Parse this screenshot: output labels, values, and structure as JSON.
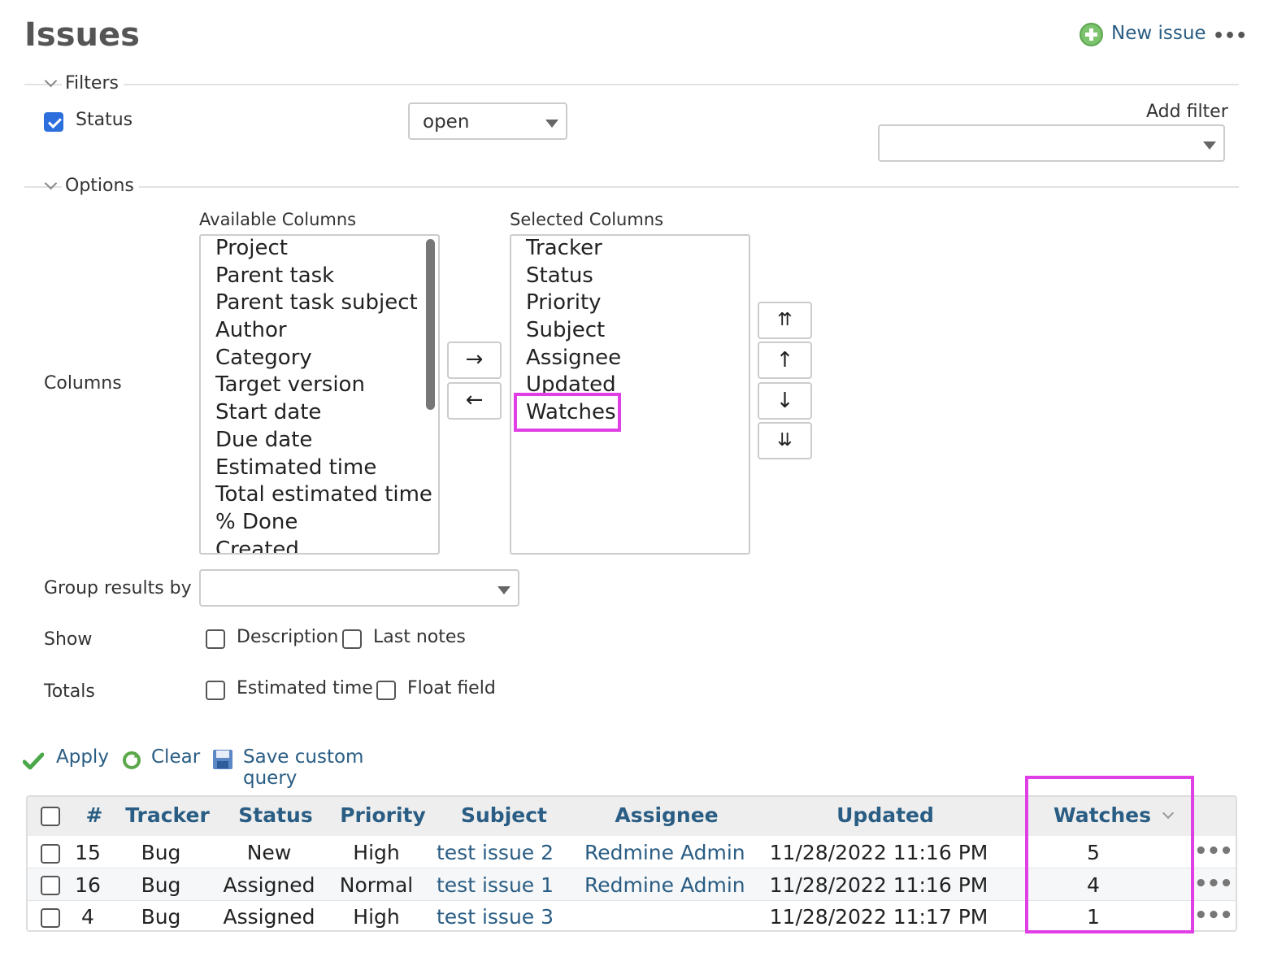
{
  "page": {
    "title": "Issues"
  },
  "header": {
    "new_issue_label": "New issue",
    "more_label": "•••"
  },
  "filters": {
    "legend": "Filters",
    "status_label": "Status",
    "status_operator": "open",
    "add_filter_label": "Add filter",
    "add_filter_value": ""
  },
  "options": {
    "legend": "Options",
    "columns_label": "Columns",
    "available_label": "Available Columns",
    "available_columns": [
      "Project",
      "Parent task",
      "Parent task subject",
      "Author",
      "Category",
      "Target version",
      "Start date",
      "Due date",
      "Estimated time",
      "Total estimated time",
      "% Done",
      "Created"
    ],
    "selected_label": "Selected Columns",
    "selected_columns": [
      "Tracker",
      "Status",
      "Priority",
      "Subject",
      "Assignee",
      "Updated",
      "Watches"
    ],
    "add_arrow": "→",
    "remove_arrow": "←",
    "move_top": "⇈",
    "move_up": "↑",
    "move_down": "↓",
    "move_bottom": "⇊",
    "group_by_label": "Group results by",
    "group_by_value": "",
    "show_label": "Show",
    "show_description": "Description",
    "show_last_notes": "Last notes",
    "totals_label": "Totals",
    "totals_estimated": "Estimated time",
    "totals_float": "Float field"
  },
  "actions": {
    "apply": "Apply",
    "clear": "Clear",
    "save": "Save custom query"
  },
  "table": {
    "headers": {
      "id": "#",
      "tracker": "Tracker",
      "status": "Status",
      "priority": "Priority",
      "subject": "Subject",
      "assignee": "Assignee",
      "updated": "Updated",
      "watches": "Watches"
    },
    "rows": [
      {
        "id": "15",
        "tracker": "Bug",
        "status": "New",
        "priority": "High",
        "subject": "test issue 2",
        "assignee": "Redmine Admin",
        "updated": "11/28/2022 11:16 PM",
        "watches": "5"
      },
      {
        "id": "16",
        "tracker": "Bug",
        "status": "Assigned",
        "priority": "Normal",
        "subject": "test issue 1",
        "assignee": "Redmine Admin",
        "updated": "11/28/2022 11:16 PM",
        "watches": "4"
      },
      {
        "id": "4",
        "tracker": "Bug",
        "status": "Assigned",
        "priority": "High",
        "subject": "test issue 3",
        "assignee": "",
        "updated": "11/28/2022 11:17 PM",
        "watches": "1"
      }
    ]
  },
  "colors": {
    "link": "#2a5d84",
    "highlight": "#e03fe6",
    "checkbox": "#2c6fdc"
  }
}
